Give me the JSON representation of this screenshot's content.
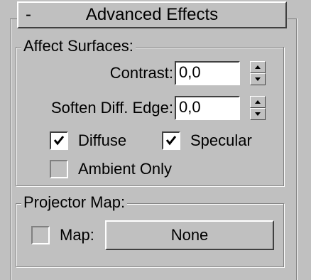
{
  "rollout": {
    "collapse_symbol": "-",
    "title": "Advanced Effects"
  },
  "affect_surfaces": {
    "group_label": "Affect Surfaces:",
    "contrast": {
      "label": "Contrast:",
      "value": "0,0"
    },
    "soften_diff_edge": {
      "label": "Soften Diff. Edge:",
      "value": "0,0"
    },
    "diffuse": {
      "label": "Diffuse",
      "checked": true
    },
    "specular": {
      "label": "Specular",
      "checked": true
    },
    "ambient_only": {
      "label": "Ambient Only",
      "checked": false
    }
  },
  "projector_map": {
    "group_label": "Projector Map:",
    "map_checkbox": {
      "label": "Map:",
      "checked": false
    },
    "map_button_label": "None"
  },
  "colors": {
    "panel_bg": "#c0c0c0",
    "field_bg": "#ffffff",
    "shadow": "#404040",
    "highlight": "#ffffff"
  },
  "icons": {
    "collapse": "minus-icon",
    "spinner_up": "triangle-up-icon",
    "spinner_down": "triangle-down-icon",
    "check": "checkmark-icon"
  }
}
